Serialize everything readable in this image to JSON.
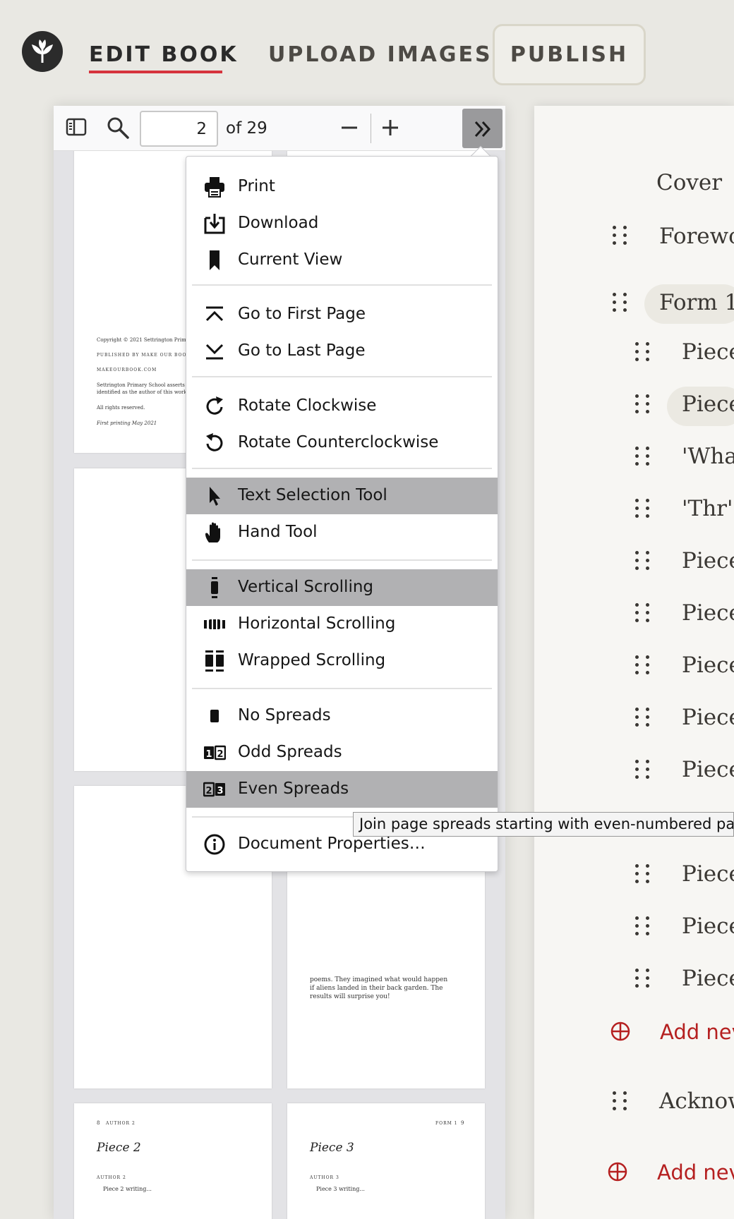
{
  "nav": {
    "edit_book": "EDIT BOOK",
    "upload_images": "UPLOAD IMAGES",
    "publish": "PUBLISH"
  },
  "toolbar": {
    "page_value": "2",
    "page_of": "of 29"
  },
  "pages": {
    "copyright": "Copyright © 2021 Settrington Primar",
    "published_by": "published by make our book",
    "site": "makeourbook.com",
    "asserts": " Settrington Primary School asserts th",
    "identified": "identified as the author of this work.",
    "rights": "All rights reserved.",
    "first_printing": "First printing May 2021",
    "poems_text": "poems. They imagined what would happen if aliens landed in their back garden. The results will surprise you!",
    "p8_num": "8",
    "p8_header": "author 2",
    "p8_title": "Piece 2",
    "p8_author": "author 2",
    "p8_body": "Piece 2 writing...",
    "p9_header": "form 1",
    "p9_num": "9",
    "p9_title": "Piece 3",
    "p9_author": "author 3",
    "p9_body": "Piece 3 writing..."
  },
  "menu": {
    "print": "Print",
    "download": "Download",
    "current_view": "Current View",
    "first_page": "Go to First Page",
    "last_page": "Go to Last Page",
    "rotate_cw": "Rotate Clockwise",
    "rotate_ccw": "Rotate Counterclockwise",
    "text_select": "Text Selection Tool",
    "hand_tool": "Hand Tool",
    "vertical_scroll": "Vertical Scrolling",
    "horizontal_scroll": "Horizontal Scrolling",
    "wrapped_scroll": "Wrapped Scrolling",
    "no_spreads": "No Spreads",
    "odd_spreads": "Odd Spreads",
    "even_spreads": "Even Spreads",
    "doc_props": "Document Properties…"
  },
  "tooltip": "Join page spreads starting with even-numbered pa",
  "toc": {
    "cover": "Cover",
    "foreword": "Forewor",
    "form1": "Form 1",
    "piece_a": "Piece",
    "piece_b": "Piece",
    "what": "'Wha",
    "thr": "'Thr'",
    "piece_c": "Piece",
    "piece_d": "Piece",
    "piece_e": "Piece",
    "piece_f": "Piece",
    "piece_g": "Piece",
    "piece_h": "Piece",
    "piece_i": "Piece",
    "piece_j": "Piece",
    "add_new_1": "Add nev",
    "acknow": "Acknow",
    "add_new_2": "Add nev"
  },
  "colors": {
    "accent_red": "#d6333d",
    "add_red": "#b52020",
    "menu_selected": "#b1b1b3"
  }
}
